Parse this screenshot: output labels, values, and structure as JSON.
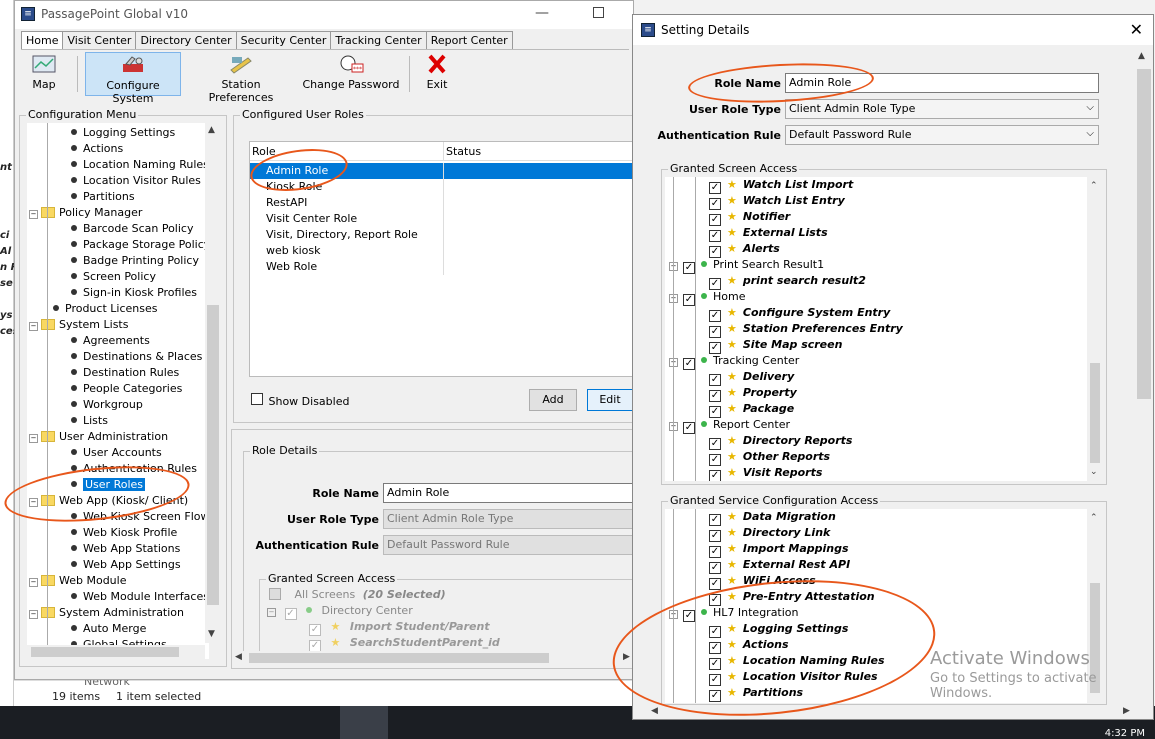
{
  "main_window": {
    "title": "PassagePoint Global v10",
    "tabs": [
      "Home",
      "Visit Center",
      "Directory Center",
      "Security Center",
      "Tracking Center",
      "Report Center"
    ],
    "toolbar": {
      "map": "Map",
      "configure_system": "Configure System",
      "station_preferences": "Station Preferences",
      "change_password": "Change Password",
      "exit": "Exit"
    },
    "config_menu": {
      "title": "Configuration Menu",
      "items": [
        {
          "label": "Logging Settings",
          "kind": "leaf"
        },
        {
          "label": "Actions",
          "kind": "leaf"
        },
        {
          "label": "Location Naming Rules",
          "kind": "leaf"
        },
        {
          "label": "Location Visitor Rules",
          "kind": "leaf"
        },
        {
          "label": "Partitions",
          "kind": "leaf"
        },
        {
          "label": "Policy Manager",
          "kind": "folder"
        },
        {
          "label": "Barcode Scan Policy",
          "kind": "leaf"
        },
        {
          "label": "Package Storage Policy",
          "kind": "leaf"
        },
        {
          "label": "Badge Printing Policy",
          "kind": "leaf"
        },
        {
          "label": "Screen Policy",
          "kind": "leaf"
        },
        {
          "label": "Sign-in Kiosk Profiles",
          "kind": "leaf"
        },
        {
          "label": "Product Licenses",
          "kind": "root-leaf"
        },
        {
          "label": "System Lists",
          "kind": "folder"
        },
        {
          "label": "Agreements",
          "kind": "leaf"
        },
        {
          "label": "Destinations & Places",
          "kind": "leaf"
        },
        {
          "label": "Destination Rules",
          "kind": "leaf"
        },
        {
          "label": "People Categories",
          "kind": "leaf"
        },
        {
          "label": "Workgroup",
          "kind": "leaf"
        },
        {
          "label": "Lists",
          "kind": "leaf"
        },
        {
          "label": "User Administration",
          "kind": "folder"
        },
        {
          "label": "User Accounts",
          "kind": "leaf"
        },
        {
          "label": "Authentication Rules",
          "kind": "leaf"
        },
        {
          "label": "User Roles",
          "kind": "leaf",
          "selected": true
        },
        {
          "label": "Web App (Kiosk/ Client)",
          "kind": "folder"
        },
        {
          "label": "Web Kiosk Screen Flow",
          "kind": "leaf"
        },
        {
          "label": "Web Kiosk Profile",
          "kind": "leaf"
        },
        {
          "label": "Web App Stations",
          "kind": "leaf"
        },
        {
          "label": "Web App Settings",
          "kind": "leaf"
        },
        {
          "label": "Web Module",
          "kind": "folder"
        },
        {
          "label": "Web Module Interfaces",
          "kind": "leaf"
        },
        {
          "label": "System Administration",
          "kind": "folder"
        },
        {
          "label": "Auto Merge",
          "kind": "leaf"
        },
        {
          "label": "Global Settings",
          "kind": "leaf"
        }
      ]
    },
    "configured_user_roles": {
      "title": "Configured User Roles",
      "col_role": "Role",
      "col_status": "Status",
      "rows": [
        "Admin Role",
        "Kiosk Role",
        "RestAPI",
        "Visit Center Role",
        "Visit, Directory, Report Role",
        "web kiosk",
        "Web Role"
      ],
      "show_disabled": "Show Disabled",
      "add": "Add",
      "edit": "Edit"
    },
    "role_details": {
      "title": "Role Details",
      "role_name_label": "Role Name",
      "role_name_value": "Admin Role",
      "user_role_type_label": "User Role Type",
      "user_role_type_value": "Client Admin Role Type",
      "auth_rule_label": "Authentication Rule",
      "auth_rule_value": "Default Password Rule",
      "granted_title": "Granted Screen Access",
      "all_screens": "All Screens",
      "selected_count": "(20 Selected)",
      "directory_center": "Directory Center",
      "import_student": "Import Student/Parent",
      "search_student": "SearchStudentParent_id"
    }
  },
  "behind": {
    "status_items": "19 items",
    "status_selected": "1 item selected",
    "network": "Network",
    "clock": "4:32 PM"
  },
  "dialog": {
    "title": "Setting Details",
    "role_name_label": "Role Name",
    "role_name_value": "Admin Role",
    "user_role_type_label": "User Role Type",
    "user_role_type_value": "Client Admin Role Type",
    "auth_rule_label": "Authentication Rule",
    "auth_rule_value": "Default Password Rule",
    "granted_screen_title": "Granted Screen Access",
    "screen_items": [
      {
        "label": "Watch List Import",
        "level": 2
      },
      {
        "label": "Watch List Entry",
        "level": 2
      },
      {
        "label": "Notifier",
        "level": 2
      },
      {
        "label": "External Lists",
        "level": 2
      },
      {
        "label": "Alerts",
        "level": 2
      },
      {
        "label": "Print Search Result1",
        "level": 1
      },
      {
        "label": "print search result2",
        "level": 2
      },
      {
        "label": "Home",
        "level": 1
      },
      {
        "label": "Configure System Entry",
        "level": 2
      },
      {
        "label": "Station Preferences Entry",
        "level": 2
      },
      {
        "label": "Site Map screen",
        "level": 2
      },
      {
        "label": "Tracking Center",
        "level": 1
      },
      {
        "label": "Delivery",
        "level": 2
      },
      {
        "label": "Property",
        "level": 2
      },
      {
        "label": "Package",
        "level": 2
      },
      {
        "label": "Report Center",
        "level": 1
      },
      {
        "label": "Directory Reports",
        "level": 2
      },
      {
        "label": "Other Reports",
        "level": 2
      },
      {
        "label": "Visit Reports",
        "level": 2
      }
    ],
    "granted_service_title": "Granted Service Configuration Access",
    "service_items": [
      {
        "label": "Data Migration",
        "level": 2
      },
      {
        "label": "Directory Link",
        "level": 2
      },
      {
        "label": "Import Mappings",
        "level": 2
      },
      {
        "label": "External Rest API",
        "level": 2
      },
      {
        "label": "WiFi Access",
        "level": 2
      },
      {
        "label": "Pre-Entry Attestation",
        "level": 2
      },
      {
        "label": "HL7 Integration",
        "level": 1
      },
      {
        "label": "Logging Settings",
        "level": 2
      },
      {
        "label": "Actions",
        "level": 2
      },
      {
        "label": "Location Naming Rules",
        "level": 2
      },
      {
        "label": "Location Visitor Rules",
        "level": 2
      },
      {
        "label": "Partitions",
        "level": 2
      }
    ]
  },
  "watermark": {
    "line1": "Activate Windows",
    "line2": "Go to Settings to activate Windows."
  },
  "colors": {
    "selection": "#0078d7",
    "annotation": "#e8571b",
    "star": "#e8b700"
  }
}
